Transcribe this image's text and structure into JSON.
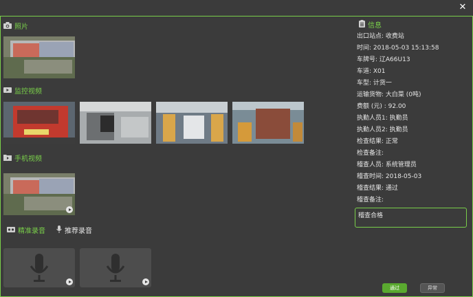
{
  "window": {
    "close_label": "✕"
  },
  "sections": {
    "photo": "照片",
    "monitor_video": "监控视频",
    "phone_video": "手机视频"
  },
  "audio": {
    "precise_tab": "精准录音",
    "recommended_tab": "推荐录音"
  },
  "info": {
    "title": "信息",
    "rows": [
      "出口站点: 收费站",
      "时间: 2018-05-03 15:13:58",
      "车牌号: 辽A66U13",
      "车道: X01",
      "车型: 计货一",
      "运输货物: 大白菜 (0吨)",
      "费额 (元) : 92.00",
      "执勤人员1: 执勤员",
      "执勤人员2: 执勤员",
      "检查结果: 正常",
      "检查备注:",
      "稽查人员: 系统管理员",
      "稽查时间: 2018-05-03",
      "稽查结果: 通过",
      "稽查备注:"
    ],
    "note_value": "稽查合格"
  },
  "buttons": {
    "pass": "通过",
    "abnormal": "异常"
  },
  "colors": {
    "accent": "#7ad04a",
    "background": "#3b3b3b"
  },
  "icons": {
    "photo": "camera-icon",
    "monitor": "video-icon",
    "phone": "folder-video-icon",
    "precise": "recorder-icon",
    "recommended": "microphone-icon",
    "info": "document-icon"
  }
}
